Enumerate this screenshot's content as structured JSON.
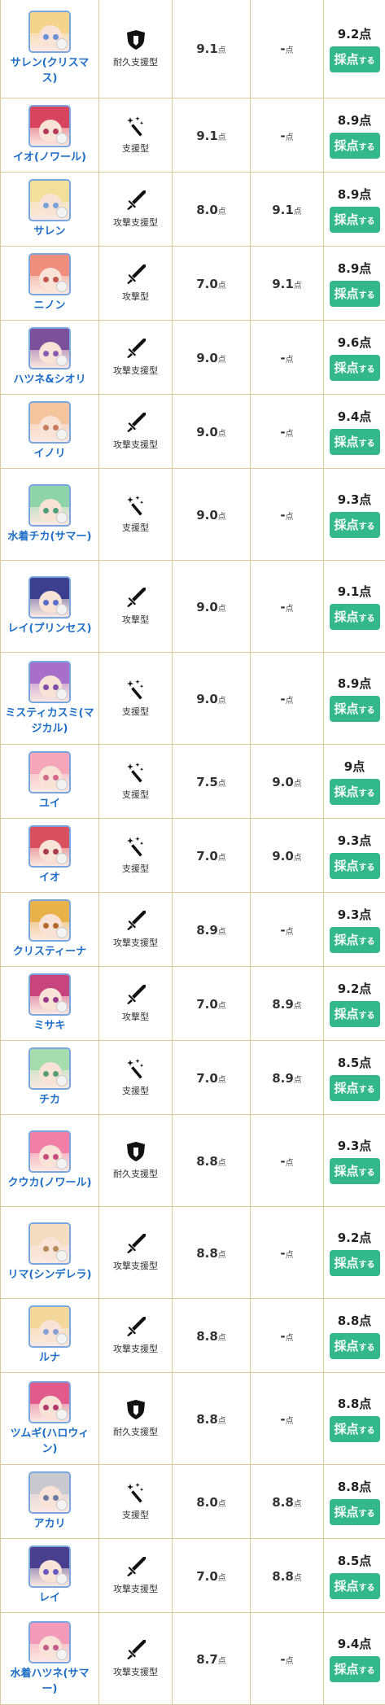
{
  "unit_point": "点",
  "type_labels": {
    "tank_support": "耐久支援型",
    "support": "支援型",
    "attack_support": "攻撃支援型",
    "attack": "攻撃型"
  },
  "button": {
    "main": "採点",
    "suffix": "する"
  },
  "rows": [
    {
      "name": "サレン(クリスマス)",
      "type": "tank_support",
      "icon": "shield-icon",
      "score1": "9.1",
      "score2": "-",
      "final": "9.2点",
      "hair": "#f3d48a",
      "eye": "#6a90d8"
    },
    {
      "name": "イオ(ノワール)",
      "type": "support",
      "icon": "magic-wand-icon",
      "score1": "9.1",
      "score2": "-",
      "final": "8.9点",
      "hair": "#d8435d",
      "eye": "#b23a56"
    },
    {
      "name": "サレン",
      "type": "attack_support",
      "icon": "sword-icon",
      "score1": "8.0",
      "score2": "9.1",
      "final": "8.9点",
      "hair": "#f1df9a",
      "eye": "#7aa2d8"
    },
    {
      "name": "ニノン",
      "type": "attack",
      "icon": "sword-icon",
      "score1": "7.0",
      "score2": "9.1",
      "final": "8.9点",
      "hair": "#ef8e7c",
      "eye": "#c2574e"
    },
    {
      "name": "ハツネ&シオリ",
      "type": "attack_support",
      "icon": "sword-icon",
      "score1": "9.0",
      "score2": "-",
      "final": "9.6点",
      "hair": "#7b4f9a",
      "eye": "#8a5bb2"
    },
    {
      "name": "イノリ",
      "type": "attack_support",
      "icon": "sword-icon",
      "score1": "9.0",
      "score2": "-",
      "final": "9.4点",
      "hair": "#f4c49e",
      "eye": "#c97a5c"
    },
    {
      "name": "水着チカ(サマー)",
      "type": "support",
      "icon": "magic-wand-icon",
      "score1": "9.0",
      "score2": "-",
      "final": "9.3点",
      "hair": "#8fd4a8",
      "eye": "#4f9e7a"
    },
    {
      "name": "レイ(プリンセス)",
      "type": "attack",
      "icon": "sword-icon",
      "score1": "9.0",
      "score2": "-",
      "final": "9.1点",
      "hair": "#3b3f8e",
      "eye": "#5a6cc8"
    },
    {
      "name": "ミスティカスミ(マジカル)",
      "type": "support",
      "icon": "magic-wand-icon",
      "score1": "9.0",
      "score2": "-",
      "final": "8.9点",
      "hair": "#a86fc8",
      "eye": "#7e4ea8"
    },
    {
      "name": "ユイ",
      "type": "support",
      "icon": "magic-wand-icon",
      "score1": "7.5",
      "score2": "9.0",
      "final": "9点",
      "hair": "#f5a6b8",
      "eye": "#d26a8a"
    },
    {
      "name": "イオ",
      "type": "support",
      "icon": "magic-wand-icon",
      "score1": "7.0",
      "score2": "9.0",
      "final": "9.3点",
      "hair": "#d9515e",
      "eye": "#a83a4a"
    },
    {
      "name": "クリスティーナ",
      "type": "attack_support",
      "icon": "sword-icon",
      "score1": "8.9",
      "score2": "-",
      "final": "9.3点",
      "hair": "#e8b14a",
      "eye": "#b26a2a"
    },
    {
      "name": "ミサキ",
      "type": "attack",
      "icon": "sword-icon",
      "score1": "7.0",
      "score2": "8.9",
      "final": "9.2点",
      "hair": "#c8447c",
      "eye": "#9a3a8a"
    },
    {
      "name": "チカ",
      "type": "support",
      "icon": "magic-wand-icon",
      "score1": "7.0",
      "score2": "8.9",
      "final": "8.5点",
      "hair": "#a6dcae",
      "eye": "#5a9e74"
    },
    {
      "name": "クウカ(ノワール)",
      "type": "tank_support",
      "icon": "shield-icon",
      "score1": "8.8",
      "score2": "-",
      "final": "9.3点",
      "hair": "#f27fa6",
      "eye": "#c84a7a"
    },
    {
      "name": "リマ(シンデレラ)",
      "type": "attack_support",
      "icon": "sword-icon",
      "score1": "8.8",
      "score2": "-",
      "final": "9.2点",
      "hair": "#f3dcc0",
      "eye": "#b88a5a"
    },
    {
      "name": "ルナ",
      "type": "attack_support",
      "icon": "sword-icon",
      "score1": "8.8",
      "score2": "-",
      "final": "8.8点",
      "hair": "#f4d79a",
      "eye": "#8aa0d4"
    },
    {
      "name": "ツムギ(ハロウィン)",
      "type": "tank_support",
      "icon": "shield-icon",
      "score1": "8.8",
      "score2": "-",
      "final": "8.8点",
      "hair": "#e05a8c",
      "eye": "#b03a6a"
    },
    {
      "name": "アカリ",
      "type": "support",
      "icon": "magic-wand-icon",
      "score1": "8.0",
      "score2": "8.8",
      "final": "8.8点",
      "hair": "#c9c9cf",
      "eye": "#6a7aa0"
    },
    {
      "name": "レイ",
      "type": "attack_support",
      "icon": "sword-icon",
      "score1": "7.0",
      "score2": "8.8",
      "final": "8.5点",
      "hair": "#4a3f8e",
      "eye": "#6a5ac0"
    },
    {
      "name": "水着ハツネ(サマー)",
      "type": "attack_support",
      "icon": "sword-icon",
      "score1": "8.7",
      "score2": "-",
      "final": "9.4点",
      "hair": "#f29ab8",
      "eye": "#c25a8a"
    }
  ]
}
